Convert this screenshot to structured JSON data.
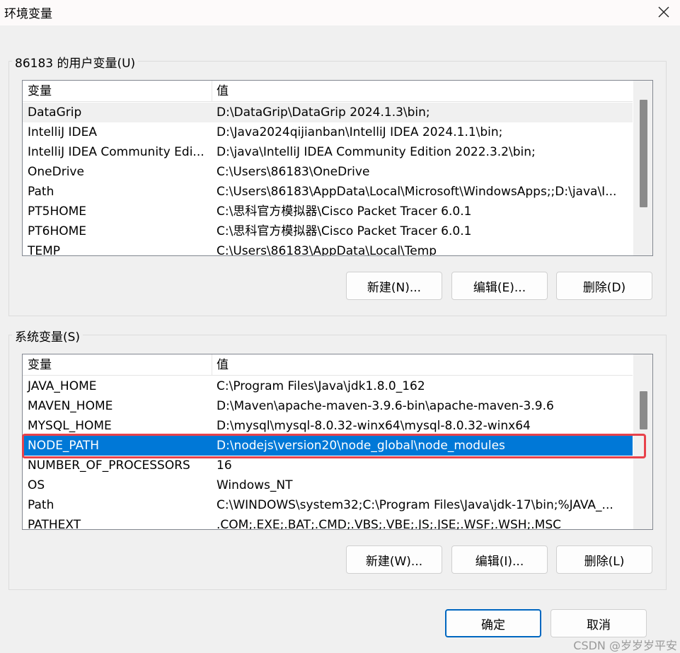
{
  "window": {
    "title": "环境变量",
    "close_icon": "close-icon"
  },
  "user_vars": {
    "group_label": "86183 的用户变量(U)",
    "columns": {
      "name": "变量",
      "value": "值"
    },
    "rows": [
      {
        "name": "DataGrip",
        "value": "D:\\DataGrip\\DataGrip 2024.1.3\\bin;"
      },
      {
        "name": "IntelliJ IDEA",
        "value": "D:\\Java2024qijianban\\IntelliJ IDEA 2024.1.1\\bin;"
      },
      {
        "name": "IntelliJ IDEA Community Edi...",
        "value": "D:\\java\\IntelliJ IDEA Community Edition 2022.3.2\\bin;"
      },
      {
        "name": "OneDrive",
        "value": "C:\\Users\\86183\\OneDrive"
      },
      {
        "name": "Path",
        "value": "C:\\Users\\86183\\AppData\\Local\\Microsoft\\WindowsApps;;D:\\java\\I..."
      },
      {
        "name": "PT5HOME",
        "value": "C:\\思科官方模拟器\\Cisco Packet Tracer 6.0.1"
      },
      {
        "name": "PT6HOME",
        "value": "C:\\思科官方模拟器\\Cisco Packet Tracer 6.0.1"
      },
      {
        "name": "TEMP",
        "value": "C:\\Users\\86183\\AppData\\Local\\Temp"
      }
    ],
    "buttons": {
      "new": "新建(N)...",
      "edit": "编辑(E)...",
      "delete": "删除(D)"
    }
  },
  "system_vars": {
    "group_label": "系统变量(S)",
    "columns": {
      "name": "变量",
      "value": "值"
    },
    "rows": [
      {
        "name": "JAVA_HOME",
        "value": "C:\\Program Files\\Java\\jdk1.8.0_162"
      },
      {
        "name": "MAVEN_HOME",
        "value": "D:\\Maven\\apache-maven-3.9.6-bin\\apache-maven-3.9.6"
      },
      {
        "name": "MYSQL_HOME",
        "value": "D:\\mysql\\mysql-8.0.32-winx64\\mysql-8.0.32-winx64"
      },
      {
        "name": "NODE_PATH",
        "value": "D:\\nodejs\\version20\\node_global\\node_modules"
      },
      {
        "name": "NUMBER_OF_PROCESSORS",
        "value": "16"
      },
      {
        "name": "OS",
        "value": "Windows_NT"
      },
      {
        "name": "Path",
        "value": "C:\\WINDOWS\\system32;C:\\Program Files\\Java\\jdk-17\\bin;%JAVA_..."
      },
      {
        "name": "PATHEXT",
        "value": ".COM;.EXE;.BAT;.CMD;.VBS;.VBE;.JS;.JSE;.WSF;.WSH;.MSC"
      }
    ],
    "selected_row": "NODE_PATH",
    "buttons": {
      "new": "新建(W)...",
      "edit": "编辑(I)...",
      "delete": "删除(L)"
    }
  },
  "footer": {
    "ok": "确定",
    "cancel": "取消"
  },
  "watermark": "CSDN @岁岁岁平安",
  "colors": {
    "selection": "#0078d7",
    "annotation_box": "#e8424b",
    "primary_border": "#0067c0"
  }
}
